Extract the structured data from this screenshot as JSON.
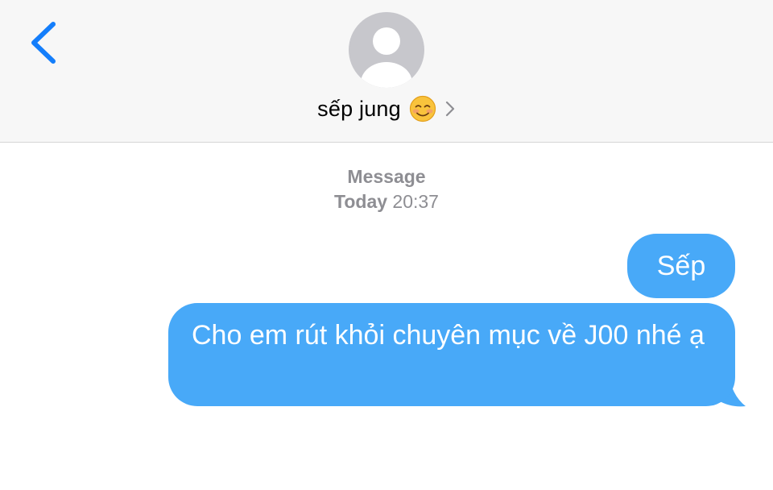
{
  "header": {
    "contact_name": "sếp jung",
    "contact_emoji_icon": "smiling-face-blushing-icon",
    "back_icon": "chevron-left-icon",
    "disclosure_icon": "chevron-right-icon",
    "avatar_icon": "default-person-avatar-icon"
  },
  "conversation": {
    "service_label": "Message",
    "timestamp_day": "Today",
    "timestamp_time": "20:37",
    "messages": [
      {
        "text": "Sếp",
        "sender": "me"
      },
      {
        "text": "Cho em rút khỏi chuyên mục về J00 nhé ạ",
        "sender": "me"
      }
    ]
  },
  "colors": {
    "accent": "#147efb",
    "bubble": "#48a9f8",
    "header_bg": "#f7f7f7",
    "meta_text": "#8e8e93",
    "avatar_bg": "#c7c7cc"
  }
}
